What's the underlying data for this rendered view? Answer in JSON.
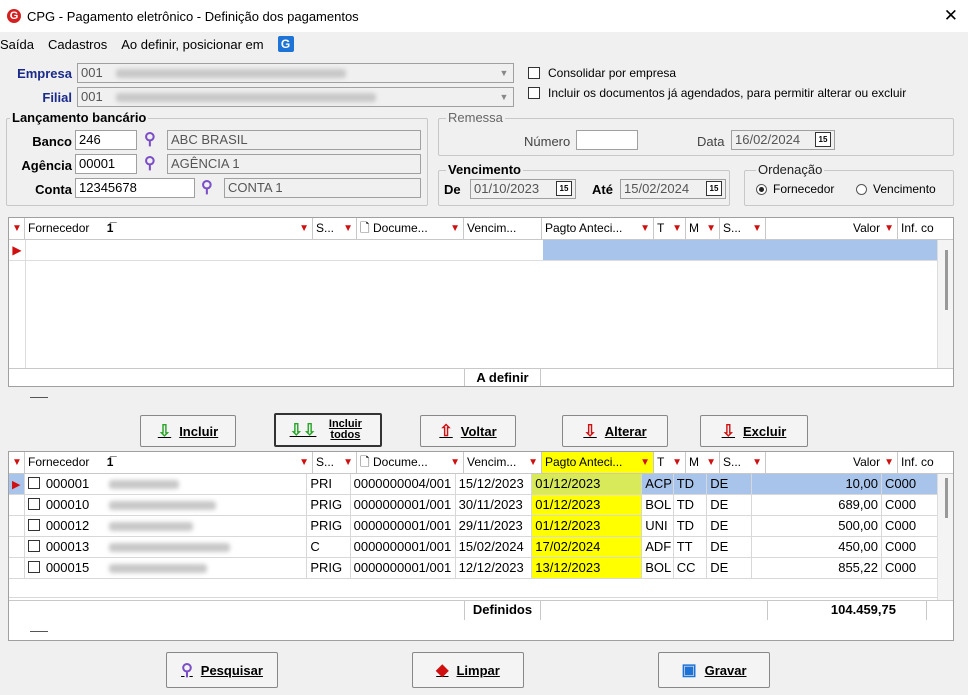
{
  "window": {
    "title": "CPG - Pagamento eletrônico - Definição dos pagamentos",
    "close": "✕",
    "logo": "G"
  },
  "menu": {
    "saida": "Saída",
    "cadastros": "Cadastros",
    "posicionar": "Ao definir, posicionar em",
    "g": "G"
  },
  "empresa": {
    "label": "Empresa",
    "code": "001"
  },
  "filial": {
    "label": "Filial",
    "code": "001"
  },
  "options": {
    "consolidar": "Consolidar por empresa",
    "incluir_agendados": "Incluir os documentos já agendados, para permitir alterar ou excluir"
  },
  "lancamento": {
    "title": "Lançamento bancário",
    "banco_label": "Banco",
    "banco": "246",
    "banco_nome": "ABC BRASIL",
    "agencia_label": "Agência",
    "agencia": "00001",
    "agencia_nome": "AGÊNCIA 1",
    "conta_label": "Conta",
    "conta": "12345678",
    "conta_nome": "CONTA 1"
  },
  "remessa": {
    "title": "Remessa",
    "numero_label": "Número",
    "numero": "",
    "data_label": "Data",
    "data": "16/02/2024"
  },
  "vencimento": {
    "title": "Vencimento",
    "de_label": "De",
    "de": "01/10/2023",
    "ate_label": "Até",
    "ate": "15/02/2024"
  },
  "ordenacao": {
    "title": "Ordenação",
    "fornecedor": "Fornecedor",
    "vencimento": "Vencimento"
  },
  "columns": {
    "fornecedor": "Fornecedor",
    "s": "S...",
    "documento": "Docume...",
    "vencimento": "Vencim...",
    "pagto": "Pagto Anteci...",
    "t": "T",
    "m": "M",
    "s2": "S...",
    "valor": "Valor",
    "inf": "Inf. co"
  },
  "top_grid": {
    "footer_label": "A definir"
  },
  "buttons": {
    "incluir": "Incluir",
    "incluir_todos": "Incluir todos",
    "voltar": "Voltar",
    "alterar": "Alterar",
    "excluir": "Excluir",
    "pesquisar": "Pesquisar",
    "limpar": "Limpar",
    "gravar": "Gravar"
  },
  "bottom_grid": {
    "rows": [
      {
        "code": "000001",
        "s": "PRI",
        "doc": "0000000004/001",
        "venc": "15/12/2023",
        "pagto": "01/12/2023",
        "t": "ACP",
        "m": "TD",
        "s2": "DE",
        "valor": "10,00",
        "inf": "C000"
      },
      {
        "code": "000010",
        "s": "PRIG",
        "doc": "0000000001/001",
        "venc": "30/11/2023",
        "pagto": "01/12/2023",
        "t": "BOL",
        "m": "TD",
        "s2": "DE",
        "valor": "689,00",
        "inf": "C000"
      },
      {
        "code": "000012",
        "s": "PRIG",
        "doc": "0000000001/001",
        "venc": "29/11/2023",
        "pagto": "01/12/2023",
        "t": "UNI",
        "m": "TD",
        "s2": "DE",
        "valor": "500,00",
        "inf": "C000"
      },
      {
        "code": "000013",
        "s": "C",
        "doc": "0000000001/001",
        "venc": "15/02/2024",
        "pagto": "17/02/2024",
        "t": "ADF",
        "m": "TT",
        "s2": "DE",
        "valor": "450,00",
        "inf": "C000"
      },
      {
        "code": "000015",
        "s": "PRIG",
        "doc": "0000000001/001",
        "venc": "12/12/2023",
        "pagto": "13/12/2023",
        "t": "BOL",
        "m": "CC",
        "s2": "DE",
        "valor": "855,22",
        "inf": "C000"
      }
    ],
    "footer_label": "Definidos",
    "total": "104.459,75"
  },
  "colors": {
    "label_blue": "#1a2a8a",
    "highlight": "#ffff00",
    "selected_row": "#a9c4ea"
  }
}
